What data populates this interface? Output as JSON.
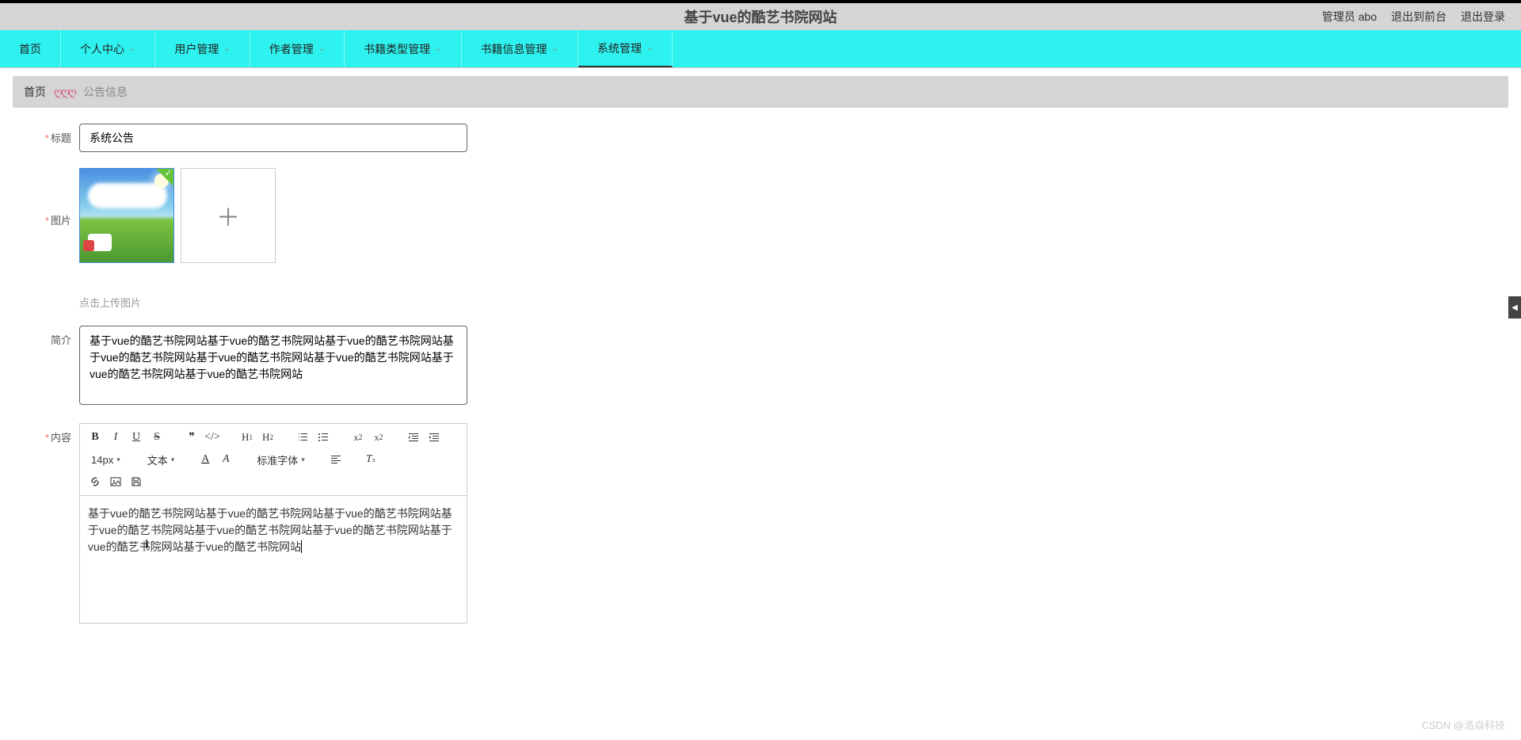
{
  "header": {
    "title": "基于vue的酷艺书院网站",
    "links": {
      "admin": "管理员 abo",
      "front": "退出到前台",
      "logout": "退出登录"
    }
  },
  "nav": {
    "items": [
      {
        "label": "首页",
        "has_children": false
      },
      {
        "label": "个人中心",
        "has_children": true
      },
      {
        "label": "用户管理",
        "has_children": true
      },
      {
        "label": "作者管理",
        "has_children": true
      },
      {
        "label": "书籍类型管理",
        "has_children": true
      },
      {
        "label": "书籍信息管理",
        "has_children": true
      },
      {
        "label": "系统管理",
        "has_children": true,
        "active": true
      }
    ]
  },
  "breadcrumb": {
    "home": "首页",
    "sep": "ღღღ",
    "current": "公告信息"
  },
  "form": {
    "title_label": "标题",
    "title_value": "系统公告",
    "image_label": "图片",
    "upload_hint": "点击上传图片",
    "intro_label": "简介",
    "intro_value": "基于vue的酷艺书院网站基于vue的酷艺书院网站基于vue的酷艺书院网站基于vue的酷艺书院网站基于vue的酷艺书院网站基于vue的酷艺书院网站基于vue的酷艺书院网站基于vue的酷艺书院网站",
    "content_label": "内容",
    "editor_text": "基于vue的酷艺书院网站基于vue的酷艺书院网站基于vue的酷艺书院网站基于vue的酷艺书院网站基于vue的酷艺书院网站基于vue的酷艺书院网站基于vue的酷艺书院网站基于vue的酷艺书院网站"
  },
  "editor": {
    "font_size": "14px",
    "text_type": "文本",
    "font_family": "标准字体"
  },
  "watermark": "CSDN @浩焱科技"
}
